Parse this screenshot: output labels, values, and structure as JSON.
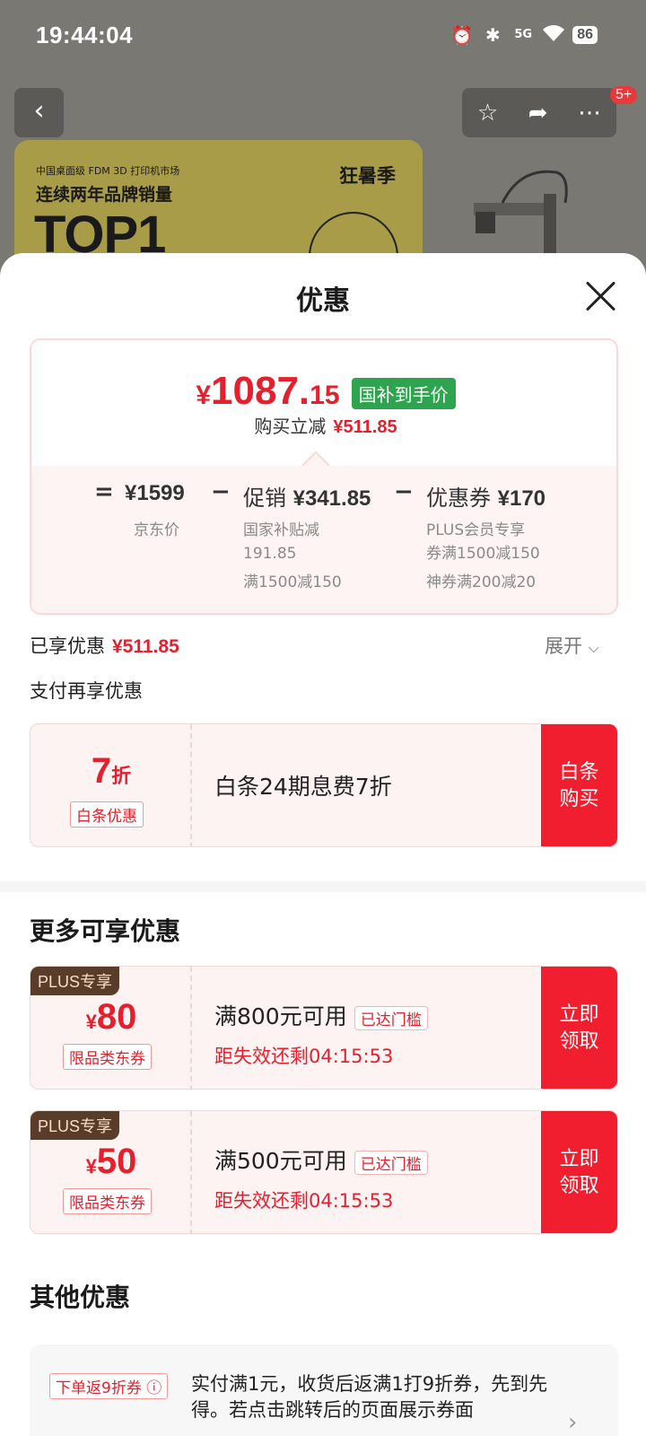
{
  "status_bar": {
    "time": "19:44:04",
    "signal": "5G",
    "battery": "86"
  },
  "background": {
    "more_badge": "5+",
    "banner": {
      "small_text": "中国桌面级 FDM 3D 打印机市场",
      "mid_text": "连续两年品牌销量",
      "top_text": "TOP1",
      "season_text": "狂暑季"
    }
  },
  "sheet": {
    "title": "优惠",
    "price_card": {
      "currency": "¥",
      "price_int": "1087.",
      "price_dec": "15",
      "price_tag": "国补到手价",
      "reduce_label": "购买立减",
      "reduce_amount": "¥511.85",
      "equation": {
        "eq": "=",
        "jd_price": "¥1599",
        "jd_price_label": "京东价",
        "minus1": "−",
        "promo_label": "促销",
        "promo_amount": "¥341.85",
        "promo_sub1": "国家补贴减",
        "promo_sub2": "191.85",
        "promo_sub3": "满1500减150",
        "minus2": "−",
        "coupon_label": "优惠券",
        "coupon_amount": "¥170",
        "coupon_sub1": "PLUS会员专享",
        "coupon_sub2": "券满1500减150",
        "coupon_sub3": "神券满200减20"
      }
    },
    "enjoyed_label": "已享优惠",
    "enjoyed_amount": "¥511.85",
    "expand_label": "展开",
    "pay_again_label": "支付再享优惠",
    "baitiao": {
      "discount_num": "7",
      "discount_unit": "折",
      "tag": "白条优惠",
      "desc": "白条24期息费7折",
      "button": "白条购买"
    },
    "more_title": "更多可享优惠",
    "more_coupons": [
      {
        "plus_tag": "PLUS专享",
        "currency": "¥",
        "amount": "80",
        "tag": "限品类东券",
        "condition": "满800元可用",
        "reached": "已达门槛",
        "countdown": "距失效还剩04:15:53",
        "button": "立即领取"
      },
      {
        "plus_tag": "PLUS专享",
        "currency": "¥",
        "amount": "50",
        "tag": "限品类东券",
        "condition": "满500元可用",
        "reached": "已达门槛",
        "countdown": "距失效还剩04:15:53",
        "button": "立即领取"
      }
    ],
    "other_title": "其他优惠",
    "other": {
      "tag": "下单返9折券 ⓘ",
      "text": "实付满1元，收货后返满1打9折券，先到先得。若点击跳转后的页面展示券面"
    }
  },
  "colors": {
    "accent_red": "#e5202e",
    "button_red": "#f01e2e",
    "gov_green": "#2ea44f",
    "plus_brown": "#5a3c2a"
  },
  "icons": [
    "alarm-icon",
    "bluetooth-icon",
    "signal-icon",
    "wifi-icon",
    "back-icon",
    "star-icon",
    "share-icon",
    "more-icon",
    "close-icon",
    "chevron-down-icon",
    "chevron-right-icon"
  ]
}
